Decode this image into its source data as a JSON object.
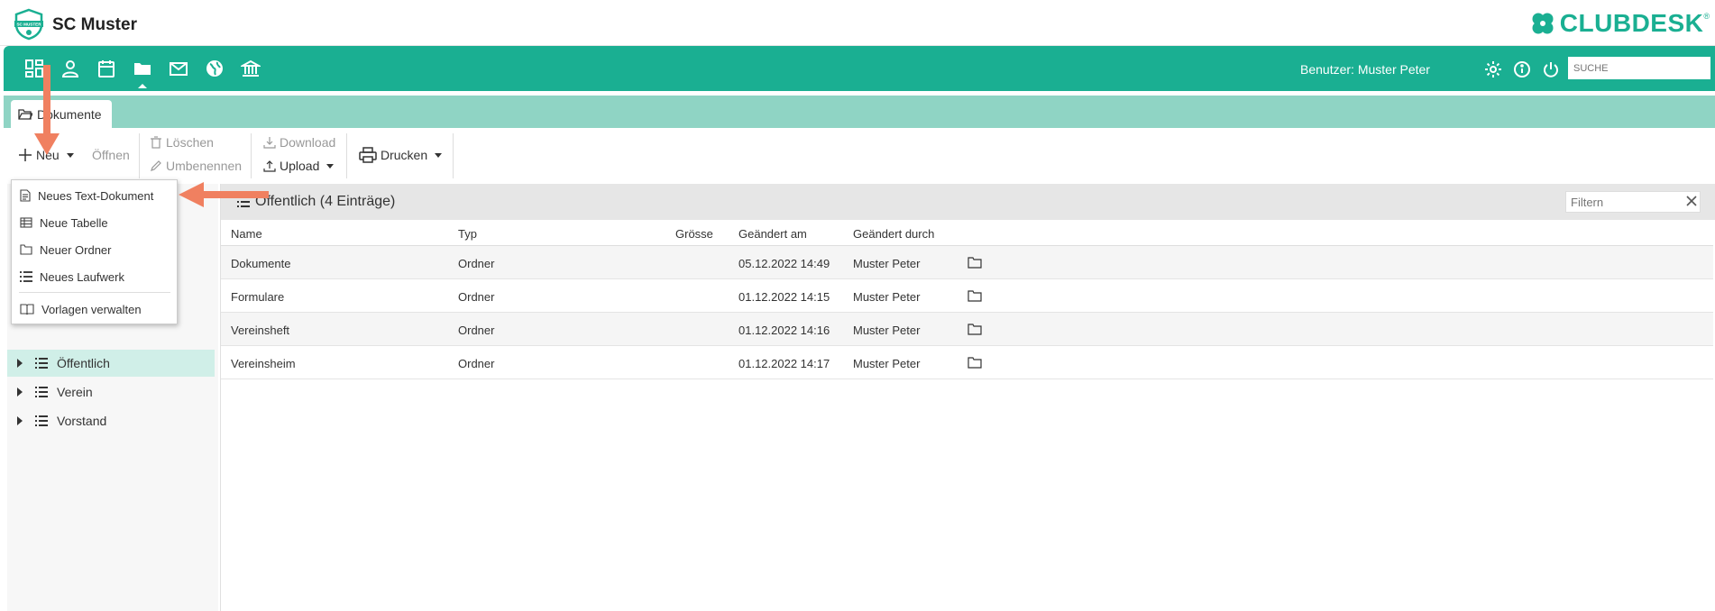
{
  "header": {
    "club_name": "SC Muster",
    "logo_text": "SC MUSTER",
    "brand_name": "CLUBDESK",
    "brand_reg": "®",
    "brand_color": "#1aaf92"
  },
  "nav": {
    "icons": [
      "dashboard-icon",
      "person-icon",
      "calendar-icon",
      "folder-icon",
      "mail-icon",
      "globe-icon",
      "bank-icon"
    ],
    "active_icon": "folder-icon",
    "user_label": "Benutzer: Muster Peter",
    "right_icons": [
      "gear-icon",
      "info-icon",
      "power-icon"
    ],
    "search_placeholder": "SUCHE"
  },
  "tabs": [
    {
      "label": "Dokumente",
      "icon": "folder-open-icon"
    }
  ],
  "toolbar": {
    "new_label": "Neu",
    "open_label": "Öffnen",
    "delete_label": "Löschen",
    "rename_label": "Umbenennen",
    "download_label": "Download",
    "upload_label": "Upload",
    "print_label": "Drucken"
  },
  "dropdown": {
    "items": [
      {
        "label": "Neues Text-Dokument",
        "icon": "document-icon"
      },
      {
        "label": "Neue Tabelle",
        "icon": "table-icon"
      },
      {
        "label": "Neuer Ordner",
        "icon": "folder-icon"
      },
      {
        "label": "Neues Laufwerk",
        "icon": "drive-icon"
      },
      {
        "label": "Vorlagen verwalten",
        "icon": "book-icon"
      }
    ]
  },
  "tree": {
    "items": [
      {
        "label": "Öffentlich",
        "selected": true
      },
      {
        "label": "Verein",
        "selected": false
      },
      {
        "label": "Vorstand",
        "selected": false
      }
    ]
  },
  "main": {
    "title": "Öffentlich (4 Einträge)",
    "filter_placeholder": "Filtern",
    "columns": [
      "Name",
      "Typ",
      "Grösse",
      "Geändert am",
      "Geändert durch"
    ],
    "rows": [
      {
        "name": "Dokumente",
        "type": "Ordner",
        "size": "",
        "modified": "05.12.2022 14:49",
        "modified_by": "Muster Peter"
      },
      {
        "name": "Formulare",
        "type": "Ordner",
        "size": "",
        "modified": "01.12.2022 14:15",
        "modified_by": "Muster Peter"
      },
      {
        "name": "Vereinsheft",
        "type": "Ordner",
        "size": "",
        "modified": "01.12.2022 14:16",
        "modified_by": "Muster Peter"
      },
      {
        "name": "Vereinsheim",
        "type": "Ordner",
        "size": "",
        "modified": "01.12.2022 14:17",
        "modified_by": "Muster Peter"
      }
    ]
  },
  "annotation_color": "#f08060"
}
